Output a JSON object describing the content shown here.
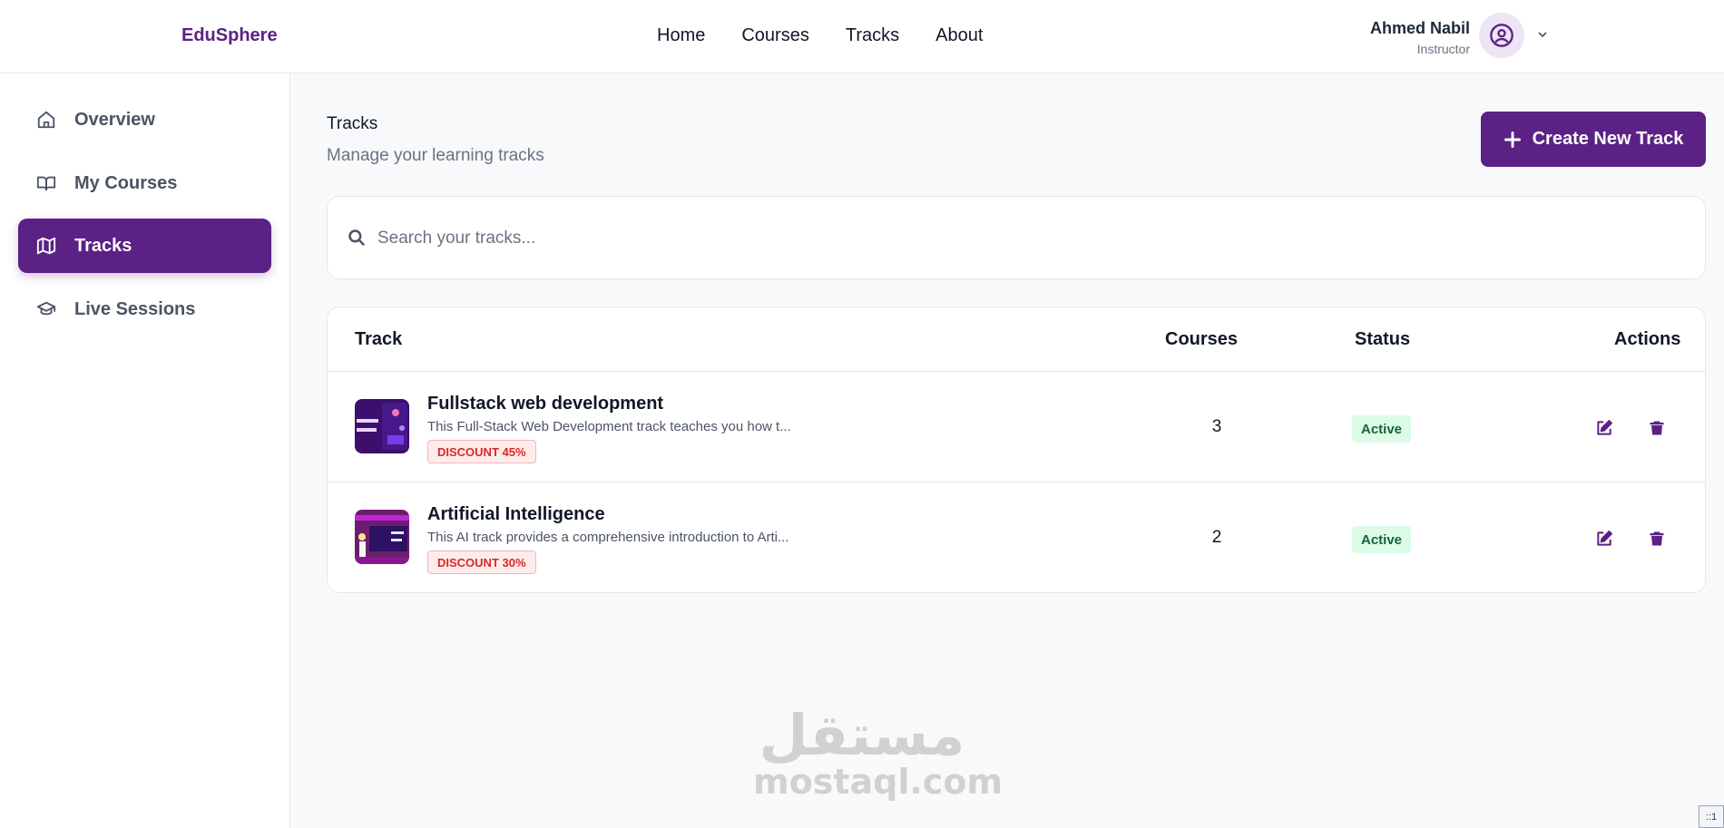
{
  "brand": "EduSphere",
  "nav": [
    "Home",
    "Courses",
    "Tracks",
    "About"
  ],
  "user": {
    "name": "Ahmed Nabil",
    "role": "Instructor"
  },
  "sidebar": {
    "items": [
      {
        "label": "Overview",
        "icon": "home-icon",
        "active": false
      },
      {
        "label": "My Courses",
        "icon": "book-icon",
        "active": false
      },
      {
        "label": "Tracks",
        "icon": "map-icon",
        "active": true
      },
      {
        "label": "Live Sessions",
        "icon": "graduation-cap-icon",
        "active": false
      }
    ]
  },
  "page": {
    "title": "Tracks",
    "subtitle": "Manage your learning tracks"
  },
  "create_button": {
    "label": "Create New Track"
  },
  "search": {
    "placeholder": "Search your tracks...",
    "value": ""
  },
  "table": {
    "headers": {
      "track": "Track",
      "courses": "Courses",
      "status": "Status",
      "actions": "Actions"
    },
    "rows": [
      {
        "title": "Fullstack web development",
        "description": "This Full-Stack Web Development track teaches you how t...",
        "badge": "DISCOUNT 45%",
        "courses": "3",
        "status": "Active"
      },
      {
        "title": "Artificial Intelligence",
        "description": "This AI track provides a comprehensive introduction to Arti...",
        "badge": "DISCOUNT 30%",
        "courses": "2",
        "status": "Active"
      }
    ]
  },
  "watermark": {
    "arabic": "مستقل",
    "latin": "mostaql.com"
  },
  "corner_label": "::1",
  "colors": {
    "primary": "#5b2185",
    "active_bg": "#dcfce7",
    "active_text": "#166534",
    "discount": "#dc2626"
  }
}
